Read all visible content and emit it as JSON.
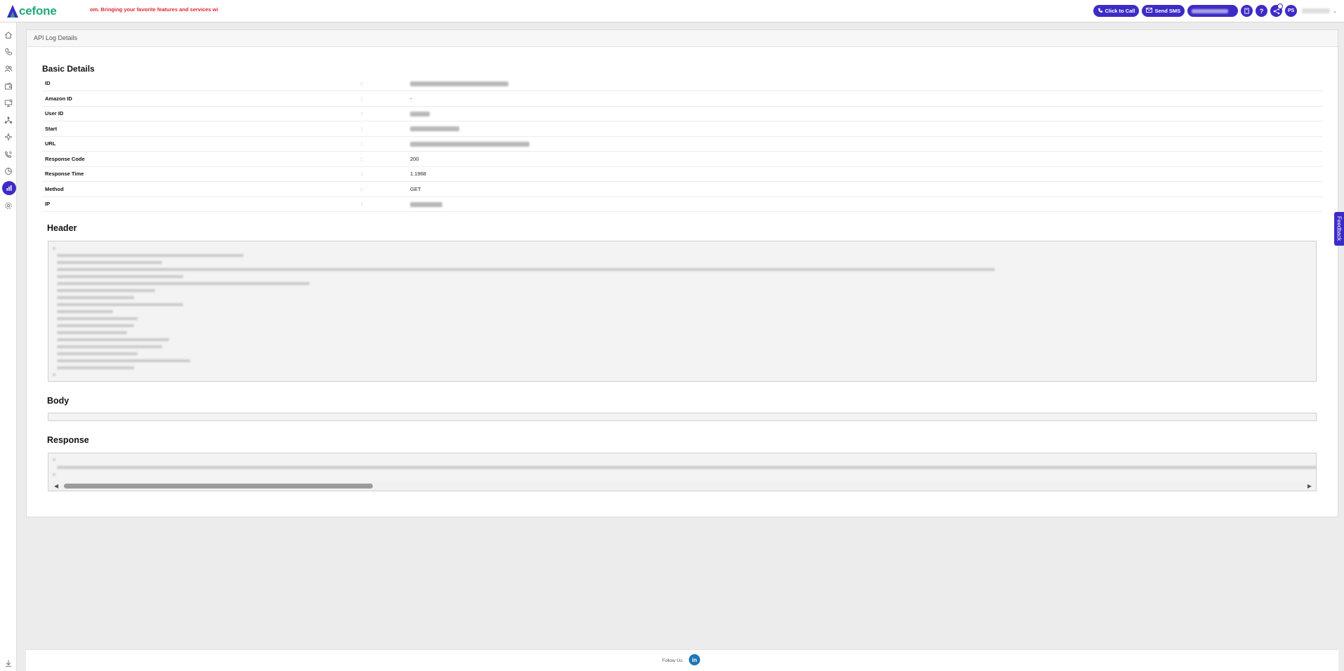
{
  "app": {
    "logo_text": "cefone",
    "marquee": "om. Bringing your favorite features and services with a ne"
  },
  "topbar": {
    "click_to_call": "Click to Call",
    "send_sms": "Send SMS",
    "help_glyph": "?",
    "avatar_initials": "PS"
  },
  "breadcrumb": "API Log Details",
  "basic_details": {
    "title": "Basic Details",
    "separator": ":",
    "rows": [
      {
        "key": "ID",
        "value": null
      },
      {
        "key": "Amazon ID",
        "value": "-"
      },
      {
        "key": "User ID",
        "value": null
      },
      {
        "key": "Start",
        "value": null
      },
      {
        "key": "URL",
        "value": null
      },
      {
        "key": "Response Code",
        "value": "200"
      },
      {
        "key": "Response Time",
        "value": "1.1968"
      },
      {
        "key": "Method",
        "value": "GET"
      },
      {
        "key": "IP",
        "value": null
      }
    ]
  },
  "sections": {
    "header": "Header",
    "body": "Body",
    "response": "Response"
  },
  "footer": {
    "follow_us": "Follow Us:",
    "linkedin_glyph": "in"
  },
  "feedback": "Feedback",
  "icons": {
    "sidebar": [
      "home-icon",
      "phone-icon",
      "contacts-icon",
      "wallet-icon",
      "monitor-icon",
      "network-icon",
      "integration-icon",
      "ivr-icon",
      "pie-chart-icon",
      "analytics-icon",
      "settings-icon"
    ],
    "bottom": "download-icon"
  },
  "colors": {
    "brand_purple": "#3d2bc6",
    "brand_green": "#1fa87a",
    "marquee_red": "#e0252f",
    "linkedin_blue": "#1f77b5"
  }
}
